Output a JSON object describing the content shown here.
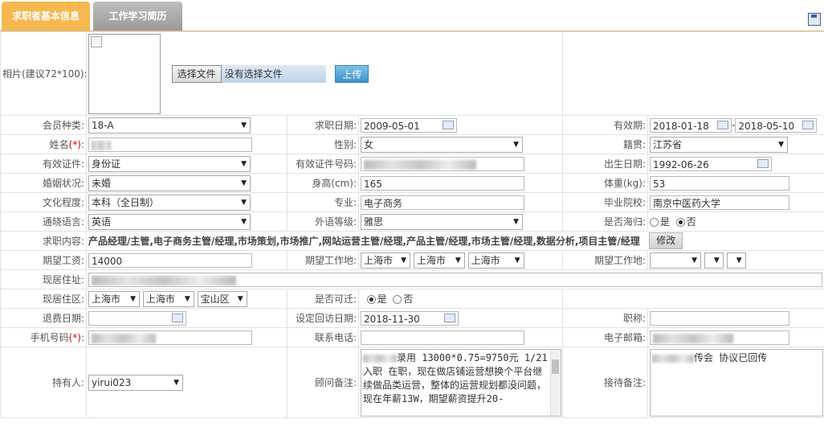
{
  "tabs": {
    "basic": "求职者基本信息",
    "history": "工作学习简历"
  },
  "photo": {
    "label": "相片(建议72*100):",
    "choose": "选择文件",
    "nofile": "没有选择文件",
    "upload": "上传"
  },
  "member_type": {
    "label": "会员种类:",
    "value": "18-A"
  },
  "job_date": {
    "label": "求职日期:",
    "value": "2009-05-01"
  },
  "validity": {
    "label": "有效期:",
    "from": "2018-01-18",
    "sep": "-",
    "to": "2018-05-10"
  },
  "name": {
    "label": "姓名",
    "req": "(*)",
    "colon": ":"
  },
  "gender": {
    "label": "性别:",
    "value": "女"
  },
  "origin": {
    "label": "籍贯:",
    "value": "江苏省"
  },
  "id_type": {
    "label": "有效证件:",
    "value": "身份证"
  },
  "id_number": {
    "label": "有效证件号码:"
  },
  "birth": {
    "label": "出生日期:",
    "value": "1992-06-26"
  },
  "marital": {
    "label": "婚姻状况:",
    "value": "未婚"
  },
  "height": {
    "label": "身高(cm):",
    "value": "165"
  },
  "weight": {
    "label": "体重(kg):",
    "value": "53"
  },
  "education": {
    "label": "文化程度:",
    "value": "本科（全日制）"
  },
  "major": {
    "label": "专业:",
    "value": "电子商务"
  },
  "school": {
    "label": "毕业院校:",
    "value": "南京中医药大学"
  },
  "language": {
    "label": "通晓语言:",
    "value": "英语"
  },
  "lang_level": {
    "label": "外语等级:",
    "value": "雅思"
  },
  "returnee": {
    "label": "是否海归:",
    "yes": "是",
    "no": "否"
  },
  "job_content": {
    "label": "求职内容:",
    "value": "产品经理/主管,电子商务主管/经理,市场策划,市场推广,网站运营主管/经理,产品主管/经理,市场主管/经理,数据分析,项目主管/经理",
    "edit": "修改"
  },
  "salary": {
    "label": "期望工资:",
    "value": "14000"
  },
  "work_place1": {
    "label": "期望工作地:",
    "a": "上海市",
    "b": "上海市",
    "c": "上海市"
  },
  "work_place2": {
    "label": "期望工作地:"
  },
  "address": {
    "label": "现居住址:"
  },
  "residence": {
    "label": "现居住区:",
    "a": "上海市",
    "b": "上海市",
    "c": "宝山区"
  },
  "relocate": {
    "label": "是否可迁:",
    "yes": "是",
    "no": "否"
  },
  "refund_date": {
    "label": "退费日期:"
  },
  "callback_date": {
    "label": "设定回访日期:",
    "value": "2018-11-30"
  },
  "title": {
    "label": "职称:"
  },
  "mobile": {
    "label": "手机号码",
    "req": "(*)",
    "colon": ":"
  },
  "phone": {
    "label": "联系电话:"
  },
  "email": {
    "label": "电子邮箱:"
  },
  "holder": {
    "label": "持有人:",
    "value": "yirui023"
  },
  "consultant_note": {
    "label": "顾问备注:",
    "value": "录用 13000*0.75=9750元 1/21入职 在职，现在做店铺运营想换个平台继续做品类运营，整体的运营规划都没问题，现在年薪13W，期望薪资提升20-"
  },
  "reception_note": {
    "label": "接待备注:",
    "value": "传会 协议已回传"
  }
}
